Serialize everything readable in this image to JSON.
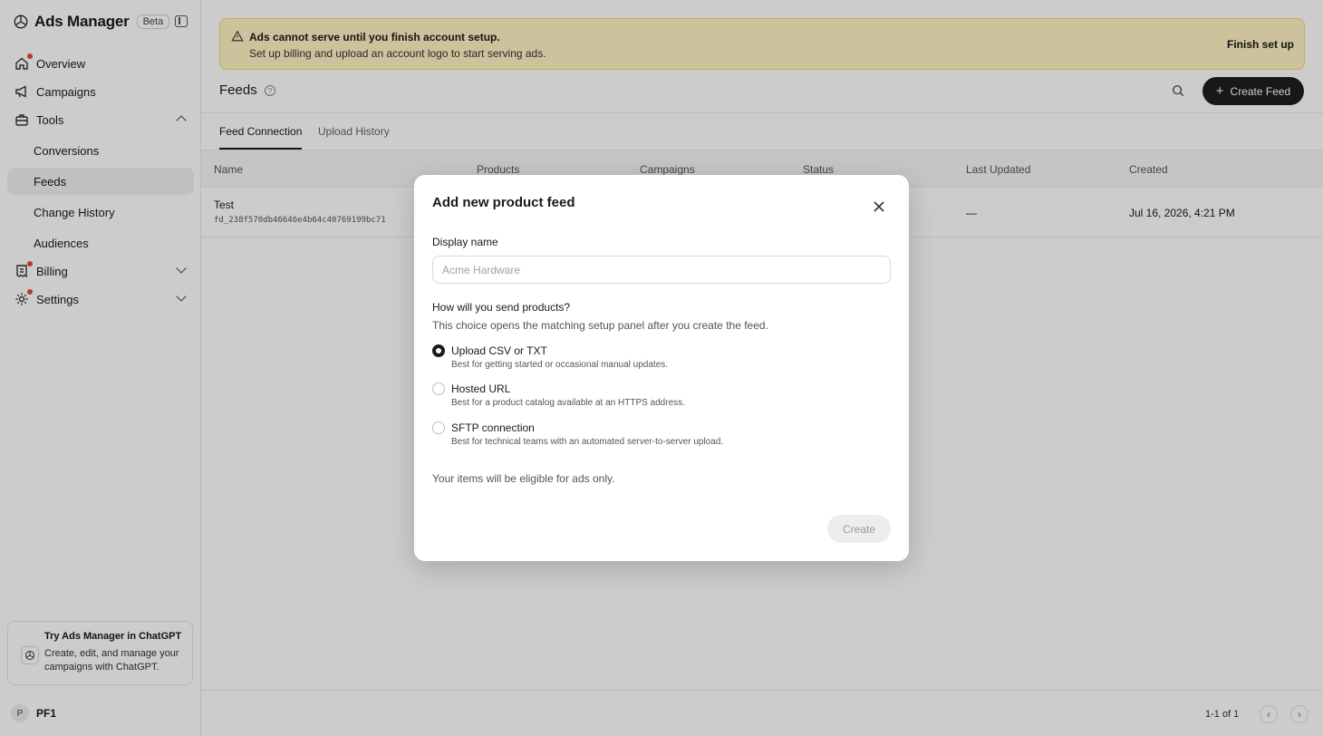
{
  "app": {
    "title": "Ads Manager",
    "badge": "Beta"
  },
  "sidebar": {
    "items": [
      {
        "label": "Overview",
        "icon": "home-icon",
        "notify": true
      },
      {
        "label": "Campaigns",
        "icon": "megaphone-icon",
        "notify": false
      },
      {
        "label": "Tools",
        "icon": "toolbox-icon",
        "notify": false,
        "expanded": true
      },
      {
        "label": "Billing",
        "icon": "receipt-icon",
        "notify": true,
        "expanded": false
      },
      {
        "label": "Settings",
        "icon": "gear-icon",
        "notify": true,
        "expanded": false
      }
    ],
    "tools_subitems": [
      {
        "label": "Conversions"
      },
      {
        "label": "Feeds",
        "active": true
      },
      {
        "label": "Change History"
      },
      {
        "label": "Audiences"
      }
    ],
    "promo": {
      "title": "Try Ads Manager in ChatGPT",
      "text": "Create, edit, and manage your campaigns with ChatGPT."
    },
    "user": {
      "initial": "P",
      "name": "PF1"
    }
  },
  "alert": {
    "title": "Ads cannot serve until you finish account setup.",
    "text": "Set up billing and upload an account logo to start serving ads.",
    "action": "Finish set up"
  },
  "header": {
    "title": "Feeds",
    "create_label": "Create Feed"
  },
  "tabs": [
    {
      "label": "Feed Connection",
      "active": true
    },
    {
      "label": "Upload History",
      "active": false
    }
  ],
  "table": {
    "columns": [
      "Name",
      "Products",
      "Campaigns",
      "Status",
      "Last Updated",
      "Created"
    ],
    "rows": [
      {
        "name": "Test",
        "id": "fd_238f570db46646e4b64c40769199bc71",
        "last_updated": "—",
        "created": "Jul 16, 2026, 4:21 PM"
      }
    ]
  },
  "pagination": {
    "info": "1-1 of 1",
    "prev": "‹",
    "next": "›"
  },
  "modal": {
    "title": "Add new product feed",
    "display_name_label": "Display name",
    "display_name_placeholder": "Acme Hardware",
    "question": "How will you send products?",
    "question_help": "This choice opens the matching setup panel after you create the feed.",
    "options": [
      {
        "title": "Upload CSV or TXT",
        "desc": "Best for getting started or occasional manual updates.",
        "selected": true
      },
      {
        "title": "Hosted URL",
        "desc": "Best for a product catalog available at an HTTPS address.",
        "selected": false
      },
      {
        "title": "SFTP connection",
        "desc": "Best for technical teams with an automated server-to-server upload.",
        "selected": false
      }
    ],
    "eligibility_note": "Your items will be eligible for ads only.",
    "create_label": "Create"
  },
  "colors": {
    "primary_button": "#1f1f1f",
    "alert_bg": "#fff3c4",
    "notify_dot": "#e04848"
  }
}
